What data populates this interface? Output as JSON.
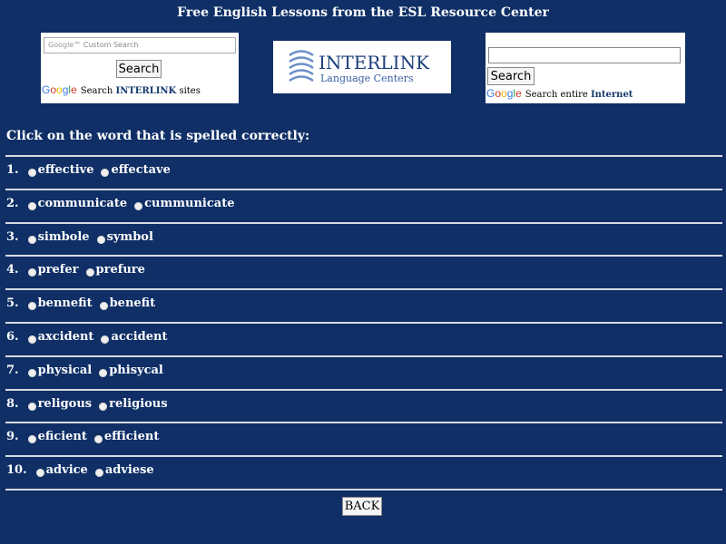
{
  "header": {
    "title": "Free English Lessons from the ESL Resource Center"
  },
  "search_left": {
    "placeholder": "Custom Search",
    "button_label": "Search",
    "footer_prefix": "Search",
    "footer_brand": "INTERLINK",
    "footer_suffix": "sites"
  },
  "logo": {
    "name": "INTERLINK",
    "subtitle": "Language Centers"
  },
  "search_right": {
    "input_value": "",
    "button_label": "Search",
    "footer_prefix": "Search entire",
    "footer_brand": "Internet"
  },
  "google": {
    "G": "G",
    "o1": "o",
    "o2": "o",
    "g": "g",
    "l": "l",
    "e": "e",
    "placeholder_logo": "Google"
  },
  "instruction": "Click on the word that is spelled correctly:",
  "questions": [
    {
      "num": "1.",
      "options": [
        "effective",
        "effectave"
      ]
    },
    {
      "num": "2.",
      "options": [
        "communicate",
        "cummunicate"
      ]
    },
    {
      "num": "3.",
      "options": [
        "simbole",
        "symbol"
      ]
    },
    {
      "num": "4.",
      "options": [
        "prefer",
        "prefure"
      ]
    },
    {
      "num": "5.",
      "options": [
        "bennefit",
        "benefit"
      ]
    },
    {
      "num": "6.",
      "options": [
        "axcident",
        "accident"
      ]
    },
    {
      "num": "7.",
      "options": [
        "physical",
        "phisycal"
      ]
    },
    {
      "num": "8.",
      "options": [
        "religous",
        "religious"
      ]
    },
    {
      "num": "9.",
      "options": [
        "eficient",
        "efficient"
      ]
    },
    {
      "num": "10.",
      "options": [
        "advice",
        "adviese"
      ]
    }
  ],
  "back_label": "BACK",
  "colors": {
    "background": "#0f2f66",
    "text": "#ffffff",
    "brand": "#14386e"
  }
}
